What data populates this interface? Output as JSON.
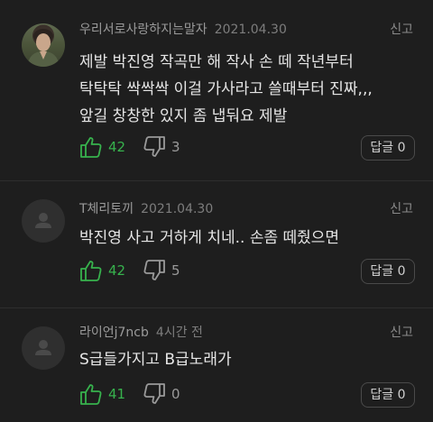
{
  "report_label": "신고",
  "reply_label": "답글",
  "colors": {
    "background": "#1e1e1e",
    "like_green": "#37b24d",
    "text": "#e6e6e6",
    "muted": "#9a9a9a"
  },
  "comments": [
    {
      "author": "우리서로사랑하지는말자",
      "date": "2021.04.30",
      "avatar": "profile-photo",
      "text": "제발 박진영 작곡만 해 작사 손 떼 작년부터\n탁탁탁 싹싹싹 이걸 가사라고 쓸때부터 진짜,,,\n앞길 창창한 있지 좀 냅둬요 제발",
      "likes": "42",
      "dislikes": "3",
      "replies": "0"
    },
    {
      "author": "T체리토끼",
      "date": "2021.04.30",
      "avatar": "default-user-icon",
      "text": "박진영 사고 거하게 치네.. 손좀 떼줬으면",
      "likes": "42",
      "dislikes": "5",
      "replies": "0"
    },
    {
      "author": "라이언j7ncb",
      "date": "4시간 전",
      "avatar": "default-user-icon",
      "text": "S급들가지고 B급노래가",
      "likes": "41",
      "dislikes": "0",
      "replies": "0"
    }
  ]
}
